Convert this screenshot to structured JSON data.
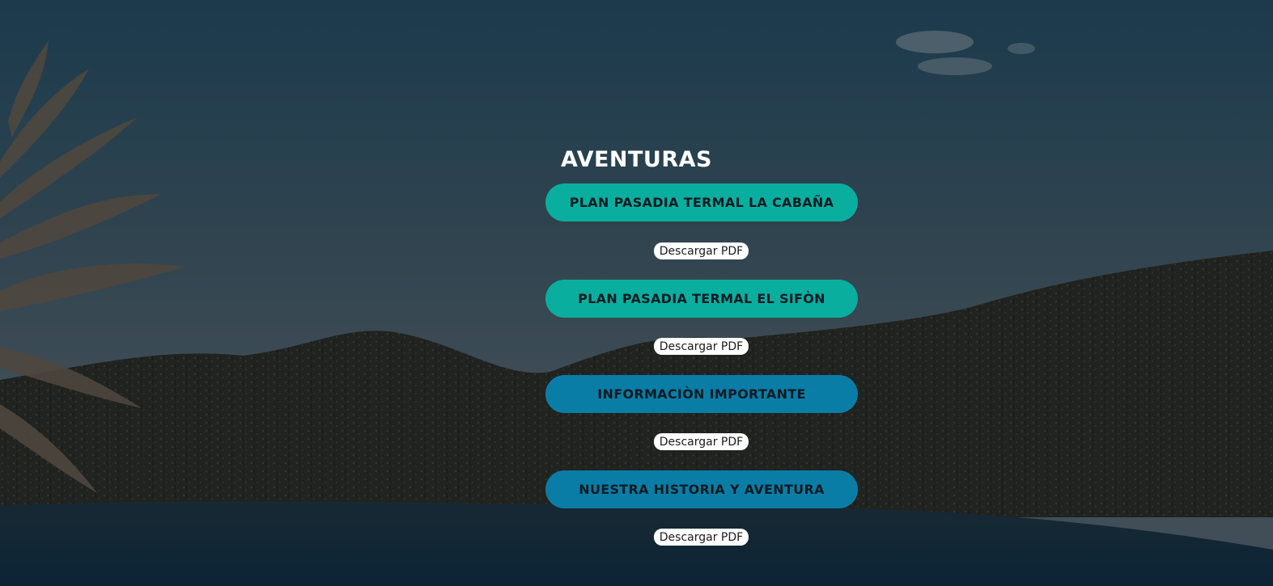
{
  "page": {
    "title": "AVENTURAS"
  },
  "colors": {
    "teal_button": "#0aae9f",
    "blue_button": "#0a7da6",
    "pdf_button": "#ffffff",
    "title_text": "#ffffff"
  },
  "plans": [
    {
      "label": "PLAN PASADIA TERMAL LA CABAÑA",
      "pdf_label": "Descargar PDF"
    },
    {
      "label": "PLAN PASADIA TERMAL EL SIFÒN",
      "pdf_label": "Descargar PDF"
    },
    {
      "label": "INFORMACIÒN IMPORTANTE",
      "pdf_label": "Descargar PDF"
    },
    {
      "label": "NUESTRA HISTORIA Y AVENTURA",
      "pdf_label": "Descargar PDF"
    }
  ]
}
